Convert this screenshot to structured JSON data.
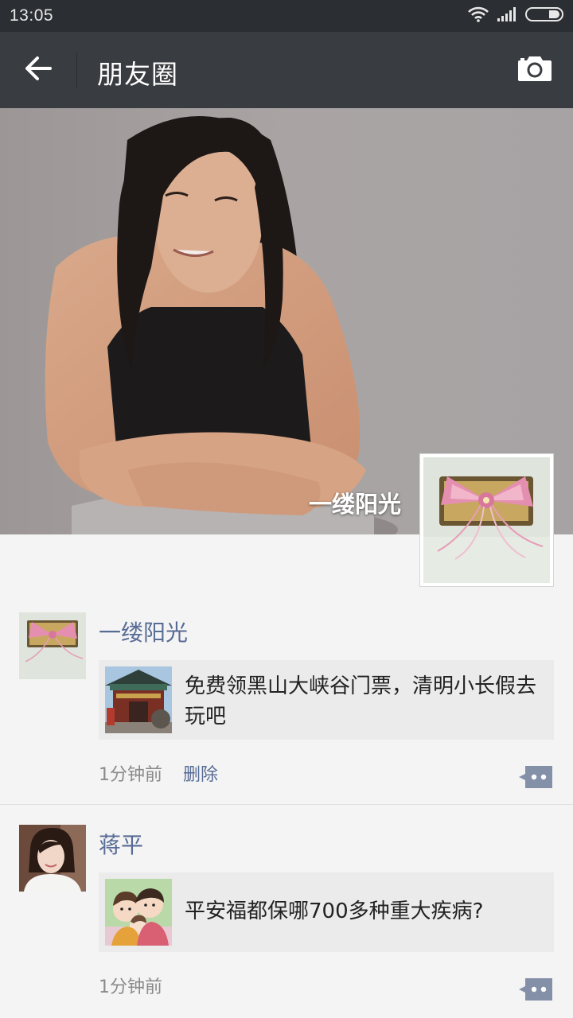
{
  "status_bar": {
    "time": "13:05",
    "icons": [
      "wifi-icon",
      "signal-icon",
      "battery-icon"
    ]
  },
  "header": {
    "title": "朋友圈",
    "back_icon": "arrow-left-icon",
    "camera_icon": "camera-icon"
  },
  "profile": {
    "name": "一缕阳光"
  },
  "posts": [
    {
      "author": "一缕阳光",
      "link_title": "免费领黑山大峡谷门票，清明小长假去玩吧",
      "time": "1分钟前",
      "delete_label": "删除"
    },
    {
      "author": "蒋平",
      "link_title": "平安福都保哪700多种重大疾病?",
      "time": "1分钟前"
    }
  ],
  "colors": {
    "status_bar_bg": "#2b2e32",
    "title_bar_bg": "#393c40",
    "name_link": "#576b95",
    "page_bg": "#f4f4f4",
    "card_bg": "#ebebeb"
  }
}
